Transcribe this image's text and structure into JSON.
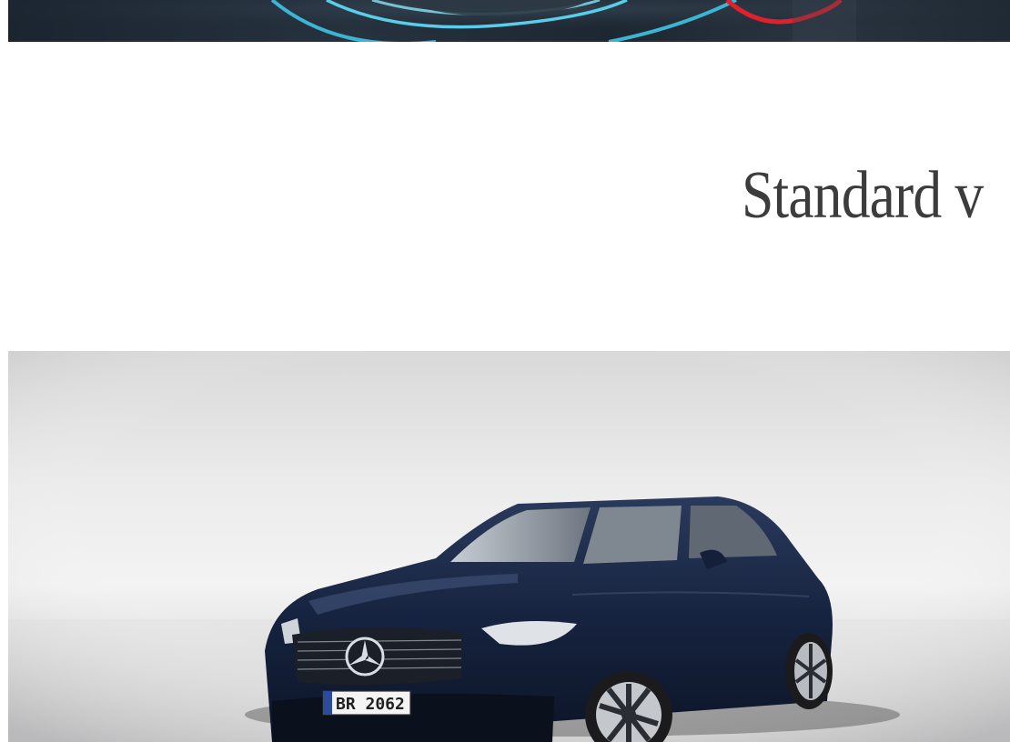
{
  "section": {
    "title": "Standard v"
  },
  "car": {
    "plate": "BR 2062"
  },
  "colors": {
    "title_text": "#3c3c3c",
    "banner_ring": "#3fc3e6",
    "banner_accent": "#e0202a",
    "car_body": "#16233f"
  }
}
